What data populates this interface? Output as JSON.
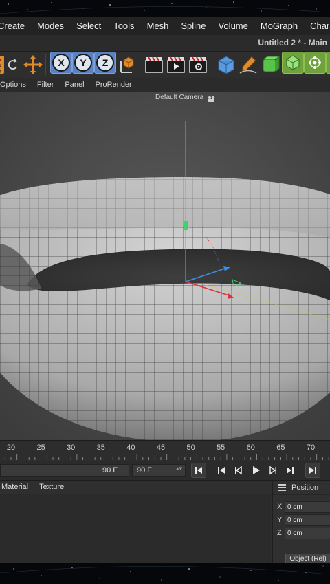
{
  "menubar": {
    "items": [
      "Create",
      "Modes",
      "Select",
      "Tools",
      "Mesh",
      "Spline",
      "Volume",
      "MoGraph",
      "Character"
    ]
  },
  "window": {
    "title": "Untitled 2 * - Main"
  },
  "toolbar": {
    "psr_icon": "psr-toggle-icon",
    "axes": [
      "X",
      "Y",
      "Z"
    ]
  },
  "viewport_menu": {
    "items": [
      "Options",
      "Filter",
      "Panel",
      "ProRender"
    ]
  },
  "viewport": {
    "camera_label": "Default Camera"
  },
  "timeline": {
    "ticks": [
      "20",
      "25",
      "30",
      "35",
      "40",
      "45",
      "50",
      "55",
      "60",
      "65",
      "70"
    ],
    "current_frame_fraction": 0.86
  },
  "transport": {
    "end_frame": "90 F",
    "max_frame": "90 F"
  },
  "material_panel": {
    "tabs": [
      "Material",
      "Texture"
    ]
  },
  "coordinates": {
    "title": "Position",
    "rows": [
      {
        "axis": "X",
        "value": "0 cm"
      },
      {
        "axis": "Y",
        "value": "0 cm"
      },
      {
        "axis": "Z",
        "value": "0 cm"
      }
    ],
    "mode_button": "Object (Rel)"
  },
  "colors": {
    "axis_y": "#3fd46a",
    "axis_x": "#e0303a",
    "axis_z": "#3a8ee8",
    "accent_blue": "#5a82c2",
    "accent_green": "#6fa23d"
  }
}
